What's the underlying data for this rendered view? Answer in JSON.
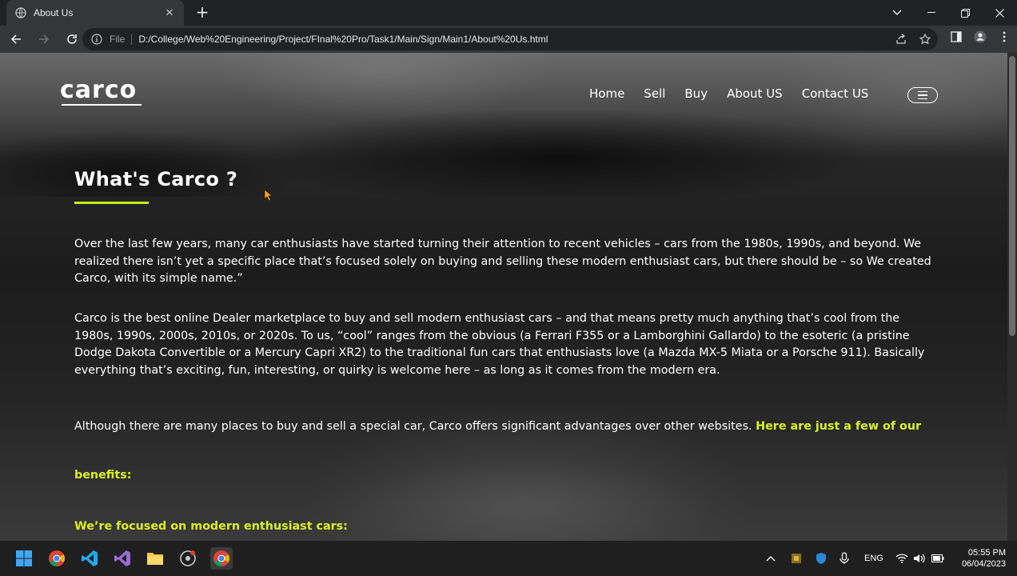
{
  "browser": {
    "tab_title": "About Us",
    "tab_close": "✕",
    "new_tab": "+",
    "scheme_label": "File",
    "url": "D:/College/Web%20Engineering/Project/FInal%20Pro/Task1/Main/Sign/Main1/About%20Us.html"
  },
  "site": {
    "logo": "carco",
    "nav": [
      "Home",
      "Sell",
      "Buy",
      "About US",
      "Contact US"
    ]
  },
  "content": {
    "heading": "What's Carco ?",
    "paragraph1": "Over the last few years, many car enthusiasts have started turning their attention to recent vehicles – cars from the 1980s, 1990s, and beyond. We realized there isn’t yet a specific place that’s focused solely on buying and selling these modern enthusiast cars, but there should be – so We created Carco, with its simple name.”",
    "paragraph2": "Carco is the best online Dealer marketplace to buy and sell modern enthusiast cars – and that means pretty much anything that’s cool from the 1980s, 1990s, 2000s, 2010s, or 2020s. To us, “cool” ranges from the obvious (a Ferrari F355 or a Lamborghini Gallardo) to the esoteric (a pristine Dodge Dakota Convertible or a Mercury Capri XR2) to the traditional fun cars that enthusiasts love (a Mazda MX-5 Miata or a Porsche 911). Basically everything that’s exciting, fun, interesting, or quirky is welcome here – as long as it comes from the modern era.",
    "paragraph3_plain": "Although there are many places to buy and sell a special car, Carco offers significant advantages over other websites. ",
    "paragraph3_accent": "Here are just a few of our",
    "benefits_label": "benefits:",
    "subheading": "We’re focused on modern enthusiast cars:"
  },
  "taskbar": {
    "language": "ENG",
    "time": "05:55 PM",
    "date": "06/04/2023"
  },
  "colors": {
    "accent": "#dcf21c",
    "heading_underline": "#c6ec1c"
  }
}
